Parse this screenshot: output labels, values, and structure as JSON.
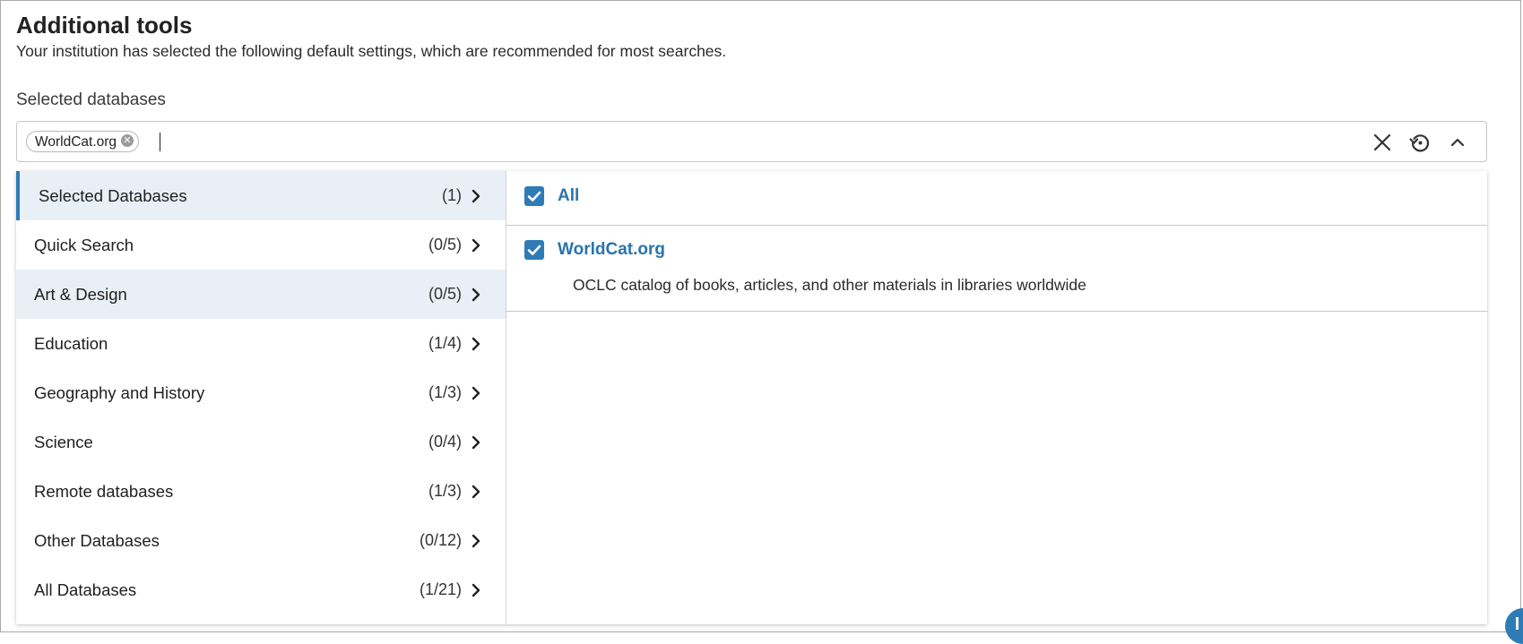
{
  "header": {
    "title": "Additional tools",
    "subtitle": "Your institution has selected the following default settings, which are recommended for most searches."
  },
  "databases_select": {
    "label": "Selected databases",
    "chip_label": "WorldCat.org",
    "icons": {
      "clear": "close-icon",
      "reset": "history-reset-icon",
      "collapse": "chevron-up-icon",
      "chip_remove": "circle-x-icon"
    }
  },
  "categories": [
    {
      "label": "Selected Databases",
      "count": "(1)"
    },
    {
      "label": "Quick Search",
      "count": "(0/5)"
    },
    {
      "label": "Art & Design",
      "count": "(0/5)"
    },
    {
      "label": "Education",
      "count": "(1/4)"
    },
    {
      "label": "Geography and History",
      "count": "(1/3)"
    },
    {
      "label": "Science",
      "count": "(0/4)"
    },
    {
      "label": "Remote databases",
      "count": "(1/3)"
    },
    {
      "label": "Other Databases",
      "count": "(0/12)"
    },
    {
      "label": "All Databases",
      "count": "(1/21)"
    }
  ],
  "database_panel": {
    "all_label": "All",
    "all_checked": true,
    "items": [
      {
        "name": "WorldCat.org",
        "description": "OCLC catalog of books, articles, and other materials in libraries worldwide",
        "checked": true
      }
    ]
  },
  "colors": {
    "accent": "#2f7bb6",
    "active_row_bg": "#e8eff6",
    "link": "#2a74ad"
  }
}
